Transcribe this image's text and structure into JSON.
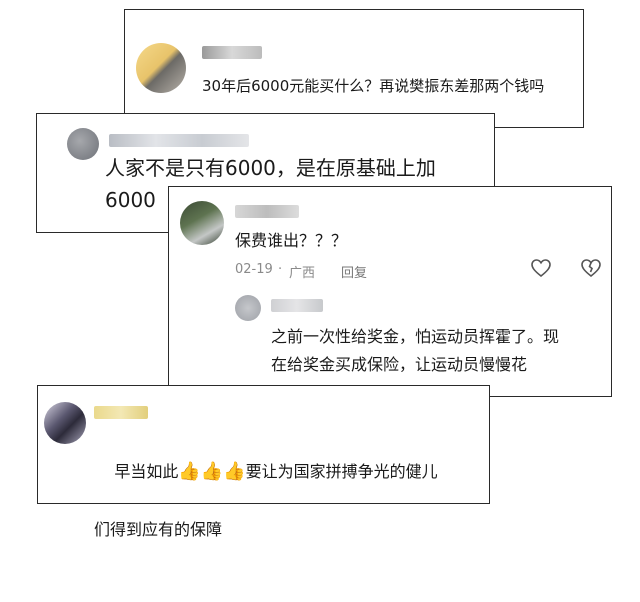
{
  "comments": [
    {
      "id": "c1",
      "text": "30年后6000元能买什么？再说樊振东差那两个钱吗"
    },
    {
      "id": "c2",
      "text": "人家不是只有6000，是在原基础上加\n6000"
    },
    {
      "id": "c3",
      "text": "保费谁出？？？",
      "date": "02-19",
      "location": "广西",
      "reply_label": "回复",
      "reply": {
        "text": "之前一次性给奖金，怕运动员挥霍了。现\n在给奖金买成保险，让运动员慢慢花"
      }
    },
    {
      "id": "c4",
      "text_before": "早当如此",
      "emoji": "👍👍👍",
      "text_after": "要让为国家拼搏争光的健儿",
      "text_line2": "们得到应有的保障"
    }
  ],
  "icons": [
    "like-heart-icon",
    "dislike-broken-heart-icon",
    "thumbs-up-emoji"
  ]
}
